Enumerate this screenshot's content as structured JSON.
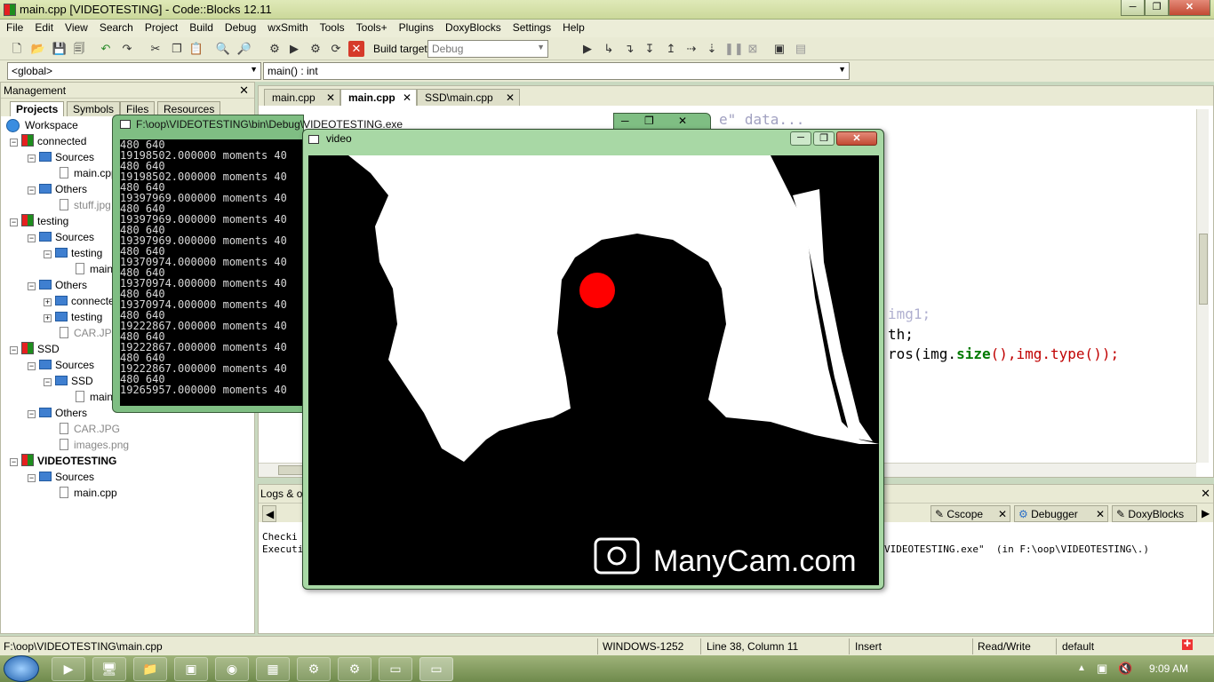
{
  "window": {
    "title": "main.cpp [VIDEOTESTING] - Code::Blocks 12.11",
    "min": "─",
    "max": "❐",
    "close": "✕"
  },
  "menu": [
    "File",
    "Edit",
    "View",
    "Search",
    "Project",
    "Build",
    "Debug",
    "wxSmith",
    "Tools",
    "Tools+",
    "Plugins",
    "DoxyBlocks",
    "Settings",
    "Help"
  ],
  "toolbar": {
    "build_target_label": "Build target:",
    "build_target_value": "Debug"
  },
  "scope": {
    "global": "<global>",
    "function": "main() : int"
  },
  "management": {
    "title": "Management",
    "close": "✕",
    "tabs": [
      "Projects",
      "Symbols",
      "Files",
      "Resources"
    ],
    "tree": [
      {
        "label": "Workspace",
        "kind": "workspace"
      },
      {
        "label": "connected",
        "kind": "project"
      },
      {
        "label": "Sources",
        "kind": "folder"
      },
      {
        "label": "main.cpp",
        "kind": "file"
      },
      {
        "label": "Others",
        "kind": "folder"
      },
      {
        "label": "stuff.jpg",
        "kind": "file"
      },
      {
        "label": "testing",
        "kind": "project"
      },
      {
        "label": "Sources",
        "kind": "folder"
      },
      {
        "label": "testing",
        "kind": "folder"
      },
      {
        "label": "main.cpp",
        "kind": "file"
      },
      {
        "label": "Others",
        "kind": "folder"
      },
      {
        "label": "connected",
        "kind": "folder"
      },
      {
        "label": "testing",
        "kind": "folder"
      },
      {
        "label": "CAR.JPG",
        "kind": "file"
      },
      {
        "label": "SSD",
        "kind": "project"
      },
      {
        "label": "Sources",
        "kind": "folder"
      },
      {
        "label": "SSD",
        "kind": "folder"
      },
      {
        "label": "main.cpp",
        "kind": "file"
      },
      {
        "label": "Others",
        "kind": "folder"
      },
      {
        "label": "CAR.JPG",
        "kind": "file"
      },
      {
        "label": "images.png",
        "kind": "file"
      },
      {
        "label": "VIDEOTESTING",
        "kind": "project"
      },
      {
        "label": "Sources",
        "kind": "folder"
      },
      {
        "label": "main.cpp",
        "kind": "file"
      }
    ]
  },
  "editor": {
    "tabs": [
      "main.cpp",
      "main.cpp",
      "SSD\\main.cpp"
    ],
    "tab_close": "✕",
    "code_fragments": [
      "e\" data...",
      "img1;",
      "th;",
      "ros(img.",
      "size",
      "(),img.type());"
    ]
  },
  "logs": {
    "title": "Logs & others",
    "tabs": [
      "Cscope",
      "Debugger",
      "DoxyBlocks"
    ],
    "lines": [
      "Checki",
      "Executi",
      "VIDEOTESTING.exe\"  (in F:\\oop\\VIDEOTESTING\\.)"
    ]
  },
  "console": {
    "title": "F:\\oop\\VIDEOTESTING\\bin\\Debug\\VIDEOTESTING.exe",
    "lines": [
      "480 640",
      "19198502.000000 moments 40",
      "480 640",
      "19198502.000000 moments 40",
      "480 640",
      "19397969.000000 moments 40",
      "480 640",
      "19397969.000000 moments 40",
      "480 640",
      "19397969.000000 moments 40",
      "480 640",
      "19370974.000000 moments 40",
      "480 640",
      "19370974.000000 moments 40",
      "480 640",
      "19370974.000000 moments 40",
      "480 640",
      "19222867.000000 moments 40",
      "480 640",
      "19222867.000000 moments 40",
      "480 640",
      "19222867.000000 moments 40",
      "480 640",
      "19265957.000000 moments 40"
    ]
  },
  "video": {
    "title": "video",
    "watermark": "ManyCam.com",
    "marker_color": "#ff0000"
  },
  "status": {
    "path": "F:\\oop\\VIDEOTESTING\\main.cpp",
    "encoding": "WINDOWS-1252",
    "position": "Line 38, Column 11",
    "mode": "Insert",
    "access": "Read/Write",
    "lang": "default"
  },
  "taskbar": {
    "time": "9:09 AM"
  }
}
